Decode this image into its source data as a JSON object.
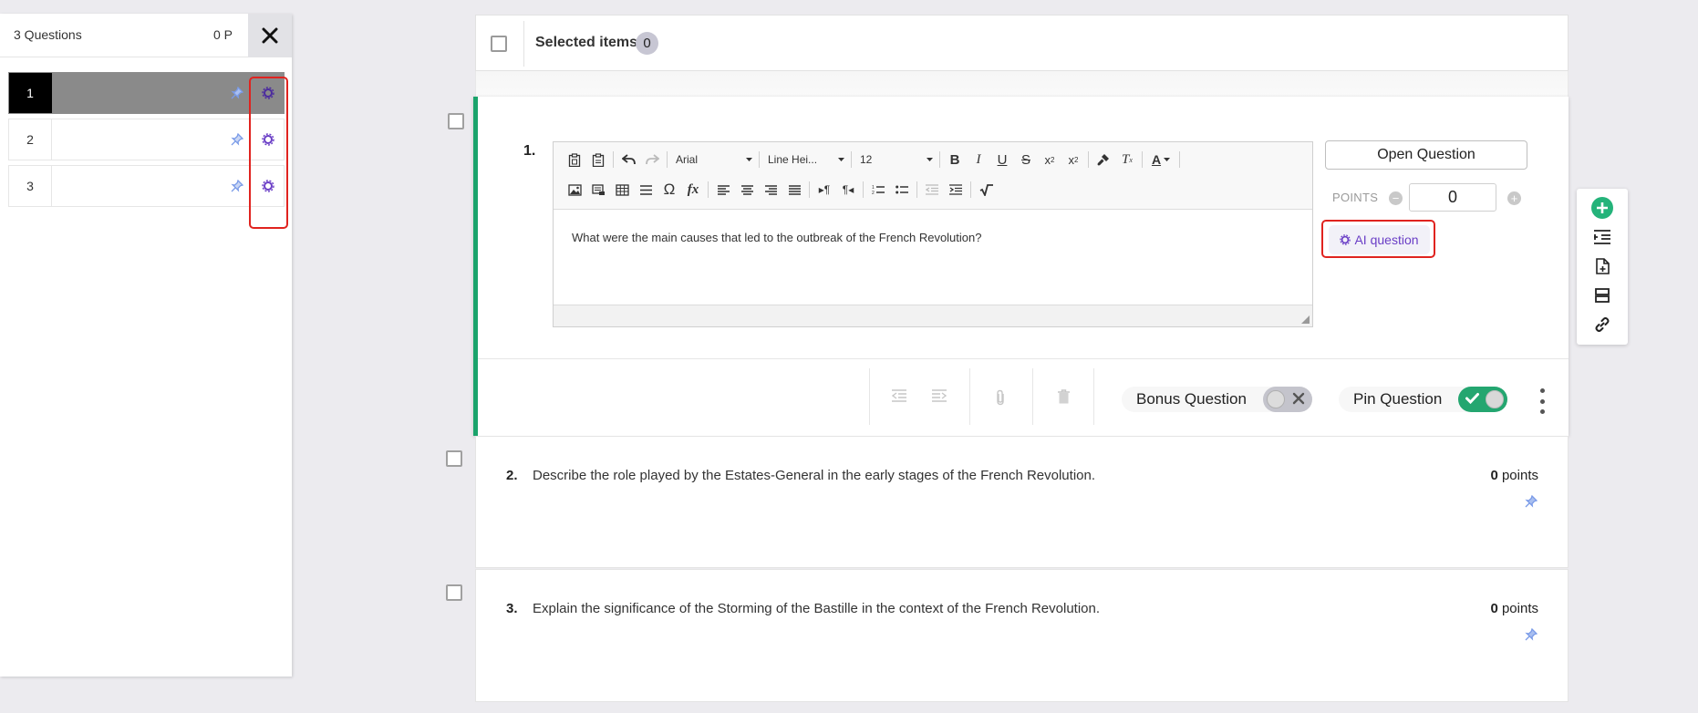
{
  "sidebar": {
    "count_label": "3 Questions",
    "points_label": "0 P",
    "items": [
      {
        "number": "1",
        "active": true
      },
      {
        "number": "2",
        "active": false
      },
      {
        "number": "3",
        "active": false
      }
    ]
  },
  "topbar": {
    "selected_label": "Selected items",
    "selected_count": "0"
  },
  "question1": {
    "number": "1.",
    "font": "Arial",
    "line_height": "Line Hei...",
    "font_size": "12",
    "text": "What were the main causes that led to the outbreak of the French Revolution?",
    "type_button": "Open Question",
    "points_label": "POINTS",
    "points_value": "0",
    "ai_button": "AI question",
    "bonus_label": "Bonus Question",
    "bonus_on": false,
    "pin_label": "Pin Question",
    "pin_on": true
  },
  "questions": [
    {
      "number": "2.",
      "text": "Describe the role played by the Estates-General in the early stages of the French Revolution.",
      "points": "0",
      "points_unit": "points"
    },
    {
      "number": "3.",
      "text": "Explain the significance of the Storming of the Bastille in the context of the French Revolution.",
      "points": "0",
      "points_unit": "points"
    }
  ],
  "colors": {
    "accent_green": "#1aa36b",
    "ai_purple": "#6a3ec6",
    "highlight_red": "#e0231f",
    "pin_blue": "#7a9be8"
  },
  "float_toolbar": [
    "add-icon",
    "indent-list-icon",
    "add-file-icon",
    "layout-rows-icon",
    "link-icon"
  ]
}
